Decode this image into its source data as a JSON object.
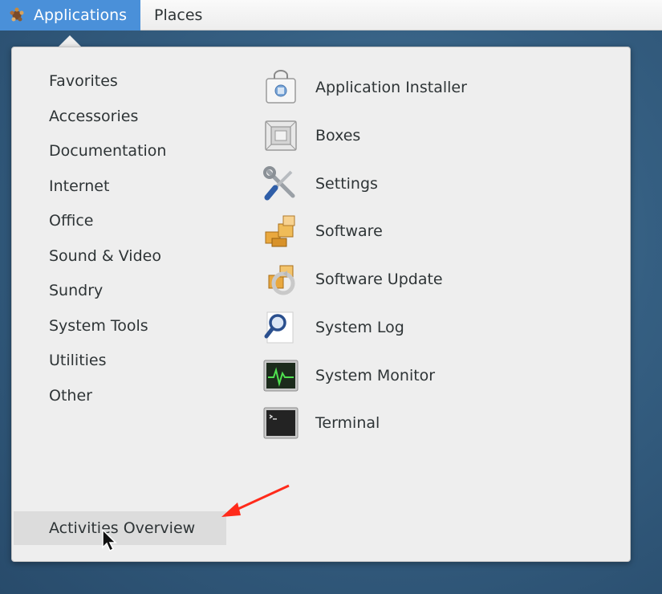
{
  "topbar": {
    "applications_label": "Applications",
    "places_label": "Places",
    "applications_icon": "gnome-foot-icon"
  },
  "menu": {
    "categories": [
      {
        "label": "Favorites"
      },
      {
        "label": "Accessories"
      },
      {
        "label": "Documentation"
      },
      {
        "label": "Internet"
      },
      {
        "label": "Office"
      },
      {
        "label": "Sound & Video"
      },
      {
        "label": "Sundry"
      },
      {
        "label": "System Tools"
      },
      {
        "label": "Utilities"
      },
      {
        "label": "Other"
      }
    ],
    "apps": [
      {
        "label": "Application Installer",
        "icon": "package-bag-icon"
      },
      {
        "label": "Boxes",
        "icon": "boxes-icon"
      },
      {
        "label": "Settings",
        "icon": "tools-icon"
      },
      {
        "label": "Software",
        "icon": "software-icon"
      },
      {
        "label": "Software Update",
        "icon": "software-update-icon"
      },
      {
        "label": "System Log",
        "icon": "system-log-icon"
      },
      {
        "label": "System Monitor",
        "icon": "system-monitor-icon"
      },
      {
        "label": "Terminal",
        "icon": "terminal-icon"
      }
    ],
    "activities_overview_label": "Activities Overview"
  },
  "colors": {
    "accent": "#4a90d9",
    "annotation_arrow": "#ff2a1a",
    "menu_background": "#eeeeee",
    "hover_background": "#dcdcdc"
  }
}
